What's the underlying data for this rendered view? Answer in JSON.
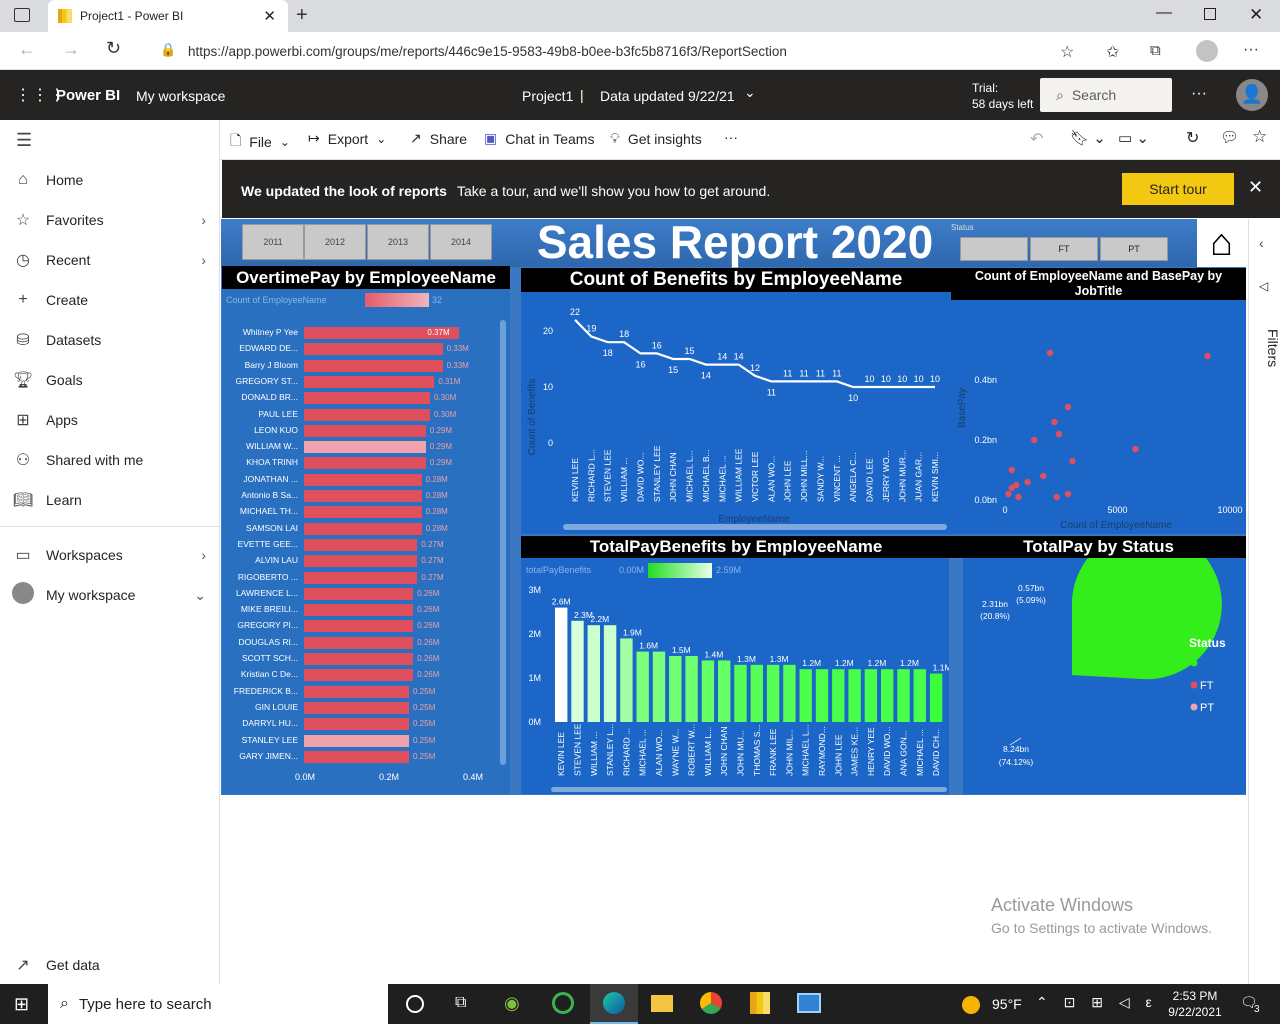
{
  "browser": {
    "tab_title": "Project1 - Power BI",
    "url": "https://app.powerbi.com/groups/me/reports/446c9e15-9583-49b8-b0ee-b3fc5b8716f3/ReportSection"
  },
  "header": {
    "app_name": "Power BI",
    "workspace": "My workspace",
    "report_name": "Project1",
    "separator": "|",
    "data_updated": "Data updated 9/22/21",
    "trial_line1": "Trial:",
    "trial_line2": "58 days left",
    "search_placeholder": "Search"
  },
  "toolbar": {
    "file": "File",
    "export": "Export",
    "share": "Share",
    "chat": "Chat in Teams",
    "insights": "Get insights",
    "more": "···"
  },
  "sidebar": {
    "items": [
      {
        "label": "Home"
      },
      {
        "label": "Favorites"
      },
      {
        "label": "Recent"
      },
      {
        "label": "Create"
      },
      {
        "label": "Datasets"
      },
      {
        "label": "Goals"
      },
      {
        "label": "Apps"
      },
      {
        "label": "Shared with me"
      },
      {
        "label": "Learn"
      },
      {
        "label": "Workspaces"
      },
      {
        "label": "My workspace"
      }
    ],
    "get_data": "Get data"
  },
  "banner": {
    "bold": "We updated the look of reports",
    "text": "Take a tour, and we'll show you how to get around.",
    "button": "Start tour"
  },
  "report": {
    "title": "Sales Report 2020",
    "years": [
      "2011",
      "2012",
      "2013",
      "2014"
    ],
    "status_label": "Status",
    "status_slicer": [
      "",
      "FT",
      "PT"
    ],
    "filters_label": "Filters"
  },
  "overtime": {
    "title": "OvertimePay by EmployeeName",
    "legend_label": "Count of EmployeeName",
    "legend_val": "32",
    "axis": [
      "0.0M",
      "0.2M",
      "0.4M"
    ],
    "rows": [
      {
        "name": "Whitney P Yee",
        "value": 0.37,
        "label": "0.37M",
        "light": false
      },
      {
        "name": "EDWARD DE...",
        "value": 0.33,
        "label": "0.33M",
        "light": false
      },
      {
        "name": "Barry J Bloom",
        "value": 0.33,
        "label": "0.33M",
        "light": false
      },
      {
        "name": "GREGORY ST...",
        "value": 0.31,
        "label": "0.31M",
        "light": false
      },
      {
        "name": "DONALD BR...",
        "value": 0.3,
        "label": "0.30M",
        "light": false
      },
      {
        "name": "PAUL LEE",
        "value": 0.3,
        "label": "0.30M",
        "light": false
      },
      {
        "name": "LEON KUO",
        "value": 0.29,
        "label": "0.29M",
        "light": false
      },
      {
        "name": "WILLIAM W...",
        "value": 0.29,
        "label": "0.29M",
        "light": true
      },
      {
        "name": "KHOA TRINH",
        "value": 0.29,
        "label": "0.29M",
        "light": false
      },
      {
        "name": "JONATHAN ...",
        "value": 0.28,
        "label": "0.28M",
        "light": false
      },
      {
        "name": "Antonio B Sa...",
        "value": 0.28,
        "label": "0.28M",
        "light": false
      },
      {
        "name": "MICHAEL TH...",
        "value": 0.28,
        "label": "0.28M",
        "light": false
      },
      {
        "name": "SAMSON LAI",
        "value": 0.28,
        "label": "0.28M",
        "light": false
      },
      {
        "name": "EVETTE GEE...",
        "value": 0.27,
        "label": "0.27M",
        "light": false
      },
      {
        "name": "ALVIN LAU",
        "value": 0.27,
        "label": "0.27M",
        "light": false
      },
      {
        "name": "RIGOBERTO ...",
        "value": 0.27,
        "label": "0.27M",
        "light": false
      },
      {
        "name": "LAWRENCE L...",
        "value": 0.26,
        "label": "0.26M",
        "light": false
      },
      {
        "name": "MIKE BREILI...",
        "value": 0.26,
        "label": "0.26M",
        "light": false
      },
      {
        "name": "GREGORY PI...",
        "value": 0.26,
        "label": "0.26M",
        "light": false
      },
      {
        "name": "DOUGLAS RI...",
        "value": 0.26,
        "label": "0.26M",
        "light": false
      },
      {
        "name": "SCOTT SCH...",
        "value": 0.26,
        "label": "0.26M",
        "light": false
      },
      {
        "name": "Kristian C De...",
        "value": 0.26,
        "label": "0.26M",
        "light": false
      },
      {
        "name": "FREDERICK B...",
        "value": 0.25,
        "label": "0.25M",
        "light": false
      },
      {
        "name": "GIN LOUIE",
        "value": 0.25,
        "label": "0.25M",
        "light": false
      },
      {
        "name": "DARRYL HU...",
        "value": 0.25,
        "label": "0.25M",
        "light": false
      },
      {
        "name": "STANLEY LEE",
        "value": 0.25,
        "label": "0.25M",
        "light": true
      },
      {
        "name": "GARY JIMEN...",
        "value": 0.25,
        "label": "0.25M",
        "light": false
      }
    ]
  },
  "benefits_count": {
    "title": "Count of Benefits by EmployeeName",
    "ylabel": "Count of Benefits",
    "xlabel": "EmployeeName",
    "yticks": [
      "0",
      "10",
      "20"
    ]
  },
  "scatter_title": "Count of EmployeeName and BasePay by JobTitle",
  "scatter": {
    "ylabel": "BasePay",
    "xlabel": "Count of EmployeeName",
    "yticks": [
      "0.0bn",
      "0.2bn",
      "0.4bn"
    ],
    "xticks": [
      "0",
      "5000",
      "10000"
    ]
  },
  "tpb": {
    "title": "TotalPayBenefits by EmployeeName",
    "legend_label": "totalPayBenefits",
    "legend_min": "0.00M",
    "legend_max": "2.59M",
    "yticks": [
      "0M",
      "1M",
      "2M",
      "3M"
    ]
  },
  "pie": {
    "title": "TotalPay by Status",
    "legend_title": "Status",
    "legend": [
      {
        "label": "",
        "color": "#33ee1a"
      },
      {
        "label": "FT",
        "color": "#df4f5d"
      },
      {
        "label": "PT",
        "color": "#f0a3ad"
      }
    ],
    "labels": {
      "big_val": "8.24bn",
      "big_pct": "(74.12%)",
      "ft_val": "2.31bn",
      "ft_pct": "(20.8%)",
      "pt_val": "0.57bn",
      "pt_pct": "(5.09%)"
    }
  },
  "watermark": {
    "line1": "Activate Windows",
    "line2": "Go to Settings to activate Windows."
  },
  "taskbar": {
    "search": "Type here to search",
    "temp": "95°F",
    "time": "2:53 PM",
    "date": "9/22/2021",
    "notif": "3"
  },
  "chart_data": [
    {
      "type": "bar",
      "title": "OvertimePay by EmployeeName",
      "orientation": "horizontal",
      "categories": [
        "Whitney P Yee",
        "EDWARD DE...",
        "Barry J Bloom",
        "GREGORY ST...",
        "DONALD BR...",
        "PAUL LEE",
        "LEON KUO",
        "WILLIAM W...",
        "KHOA TRINH",
        "JONATHAN ...",
        "Antonio B Sa...",
        "MICHAEL TH...",
        "SAMSON LAI",
        "EVETTE GEE...",
        "ALVIN LAU",
        "RIGOBERTO ...",
        "LAWRENCE L...",
        "MIKE BREILI...",
        "GREGORY PI...",
        "DOUGLAS RI...",
        "SCOTT SCH...",
        "Kristian C De...",
        "FREDERICK B...",
        "GIN LOUIE",
        "DARRYL HU...",
        "STANLEY LEE",
        "GARY JIMEN..."
      ],
      "values": [
        0.37,
        0.33,
        0.33,
        0.31,
        0.3,
        0.3,
        0.29,
        0.29,
        0.29,
        0.28,
        0.28,
        0.28,
        0.28,
        0.27,
        0.27,
        0.27,
        0.26,
        0.26,
        0.26,
        0.26,
        0.26,
        0.26,
        0.25,
        0.25,
        0.25,
        0.25,
        0.25
      ],
      "unit": "M",
      "xlim": [
        0,
        0.45
      ]
    },
    {
      "type": "line",
      "title": "Count of Benefits by EmployeeName",
      "xlabel": "EmployeeName",
      "ylabel": "Count of Benefits",
      "categories": [
        "KEVIN LEE",
        "RICHARD L...",
        "STEVEN LEE",
        "WILLIAM ...",
        "DAVID WO...",
        "STANLEY LEE",
        "JOHN CHAN",
        "MICHAEL L...",
        "MICHAEL B...",
        "MICHAEL ...",
        "WILLIAM LEE",
        "VICTOR LEE",
        "ALAN WO...",
        "JOHN LEE",
        "JOHN MILL...",
        "SANDY W...",
        "VINCENT ...",
        "ANGELA C...",
        "DAVID LEE",
        "JERRY WO...",
        "JOHN MUR...",
        "JUAN GAR...",
        "KEVIN SMI..."
      ],
      "values": [
        22,
        19,
        18,
        18,
        16,
        16,
        15,
        15,
        14,
        14,
        14,
        12,
        11,
        11,
        11,
        11,
        11,
        10,
        10,
        10,
        10,
        10,
        10
      ],
      "ylim": [
        0,
        25
      ]
    },
    {
      "type": "scatter",
      "title": "Count of EmployeeName and BasePay by JobTitle",
      "xlabel": "Count of EmployeeName",
      "ylabel": "BasePay",
      "unit_y": "bn",
      "points": [
        [
          2000,
          0.49
        ],
        [
          9000,
          0.48
        ],
        [
          2800,
          0.31
        ],
        [
          2200,
          0.26
        ],
        [
          2400,
          0.22
        ],
        [
          1300,
          0.2
        ],
        [
          3000,
          0.13
        ],
        [
          5800,
          0.17
        ],
        [
          300,
          0.1
        ],
        [
          1700,
          0.08
        ],
        [
          1000,
          0.06
        ],
        [
          2300,
          0.01
        ],
        [
          2800,
          0.02
        ],
        [
          300,
          0.04
        ],
        [
          500,
          0.05
        ],
        [
          150,
          0.02
        ],
        [
          600,
          0.01
        ]
      ],
      "xlim": [
        0,
        10000
      ],
      "ylim": [
        0,
        0.5
      ]
    },
    {
      "type": "bar",
      "title": "TotalPayBenefits by EmployeeName",
      "categories": [
        "KEVIN LEE",
        "STEVEN LEE",
        "WILLIAM ...",
        "STANLEY L...",
        "RICHARD ...",
        "MICHAEL ...",
        "ALAN WO...",
        "WAYNE W...",
        "ROBERT W...",
        "WILLIAM L...",
        "JOHN CHAN",
        "JOHN MU...",
        "THOMAS S...",
        "FRANK LEE",
        "JOHN MIL...",
        "MICHAEL L...",
        "RAYMOND...",
        "JOHN LEE",
        "JAMES KE...",
        "HENRY YEE",
        "DAVID WO...",
        "ANA GON...",
        "MICHAEL ...",
        "DAVID CH..."
      ],
      "values": [
        2.6,
        2.3,
        2.2,
        2.2,
        1.9,
        1.6,
        1.6,
        1.5,
        1.5,
        1.4,
        1.4,
        1.3,
        1.3,
        1.3,
        1.3,
        1.2,
        1.2,
        1.2,
        1.2,
        1.2,
        1.2,
        1.2,
        1.2,
        1.1
      ],
      "data_labels": [
        "2.6M",
        "2.3M",
        "2.2M",
        "",
        "1.9M",
        "1.6M",
        "",
        "1.5M",
        "",
        "1.4M",
        "",
        "1.3M",
        "",
        "1.3M",
        "",
        "1.2M",
        "",
        "1.2M",
        "",
        "1.2M",
        "",
        "1.2M",
        "",
        "1.1M"
      ],
      "unit": "M",
      "ylim": [
        0,
        3
      ]
    },
    {
      "type": "pie",
      "title": "TotalPay by Status",
      "slices": [
        {
          "name": "",
          "value": 8.24,
          "pct": 74.12
        },
        {
          "name": "FT",
          "value": 2.31,
          "pct": 20.8
        },
        {
          "name": "PT",
          "value": 0.57,
          "pct": 5.09
        }
      ],
      "unit": "bn",
      "legend": "right"
    }
  ]
}
